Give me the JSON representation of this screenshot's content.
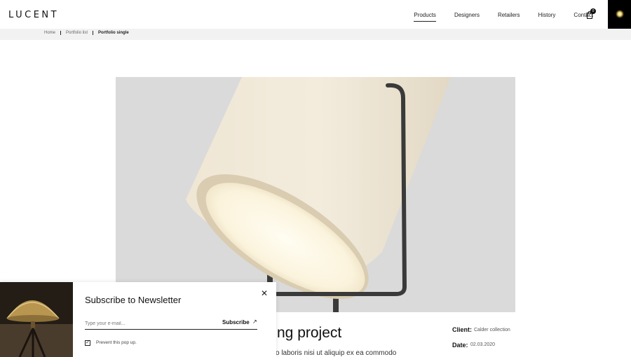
{
  "header": {
    "logo": "LUCENT",
    "nav": [
      "Products",
      "Designers",
      "Retailers",
      "History",
      "Contact"
    ],
    "active_nav": "Products",
    "cart_count": "0"
  },
  "breadcrumb": {
    "items": [
      "Home",
      "Portfolio list",
      "Portfolio single"
    ]
  },
  "project": {
    "title_visible": "ng project",
    "text_visible": "o laboris nisi ut aliquip ex ea commodo",
    "client_label": "Client:",
    "client_value": "Calder collection",
    "date_label": "Date:",
    "date_value": "02.03.2020"
  },
  "popup": {
    "title": "Subscribe to Newsletter",
    "email_placeholder": "Type your e-mail...",
    "subscribe_label": "Subscribe",
    "prevent_label": "Prevent this pop up."
  },
  "icons": {
    "cart": "shopping-bag-icon",
    "close": "close-icon",
    "arrow": "arrow-up-right-icon",
    "checkbox": "checkbox-icon"
  }
}
